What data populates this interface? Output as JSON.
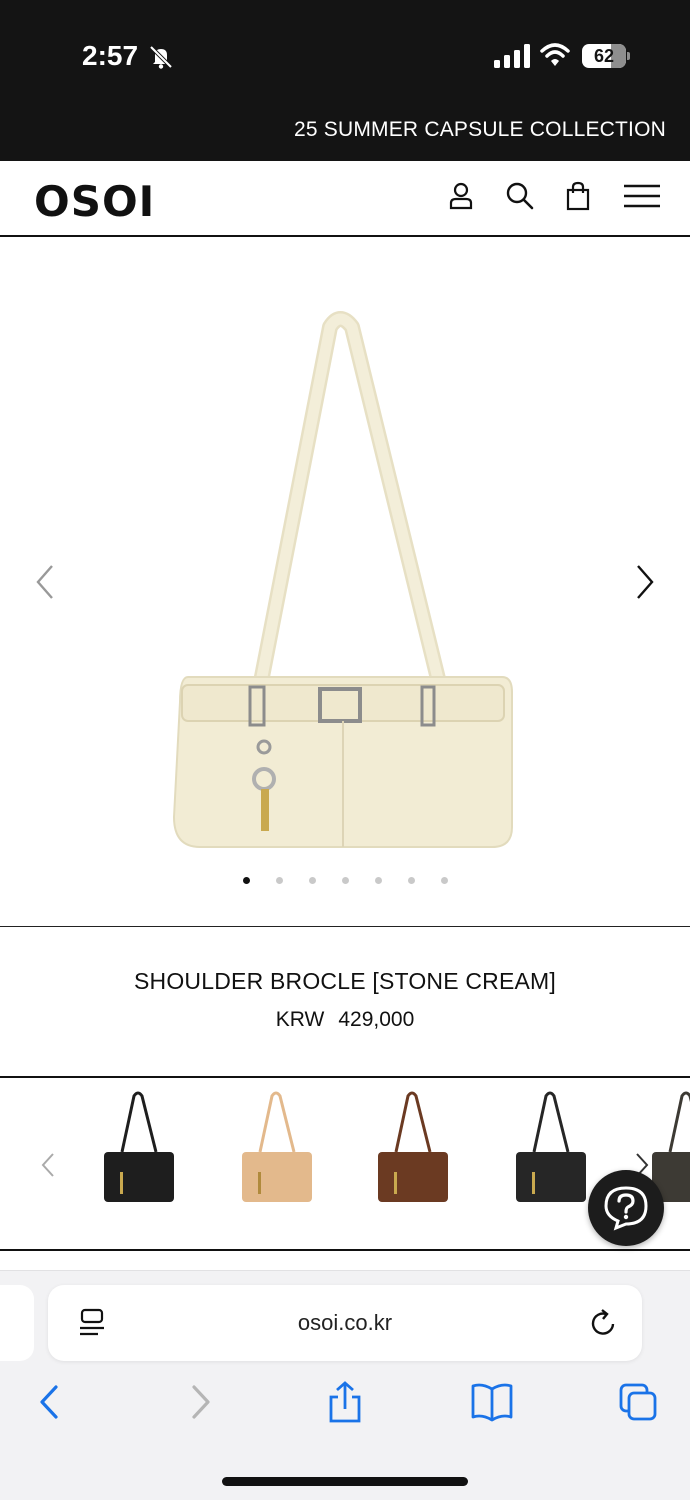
{
  "status_bar": {
    "time": "2:57",
    "battery": "62",
    "icons": [
      "bell-slash-icon",
      "cellular-signal-icon",
      "wifi-icon",
      "battery-icon"
    ]
  },
  "promo_banner": {
    "text": "25 SUMMER CAPSULE COLLECTION"
  },
  "header": {
    "logo": "OSOI",
    "icons": [
      "account-icon",
      "search-icon",
      "shopping-bag-icon",
      "menu-icon"
    ]
  },
  "gallery": {
    "slide_count": 7,
    "active_slide": 1,
    "main_bag_color": "#f0ead2"
  },
  "product": {
    "name": "SHOULDER BROCLE [STONE CREAM]",
    "currency": "KRW",
    "price": "429,000"
  },
  "color_options": [
    {
      "color": "#1e1e1e"
    },
    {
      "color": "#e3b98c"
    },
    {
      "color": "#6b3a22"
    },
    {
      "color": "#262626"
    },
    {
      "color": "#3d3a34"
    }
  ],
  "help_button": {
    "icon": "question-icon"
  },
  "browser": {
    "url": "osoi.co.kr",
    "toolbar_icons": [
      "back-icon",
      "forward-icon",
      "share-icon",
      "bookmarks-icon",
      "tabs-icon"
    ]
  }
}
